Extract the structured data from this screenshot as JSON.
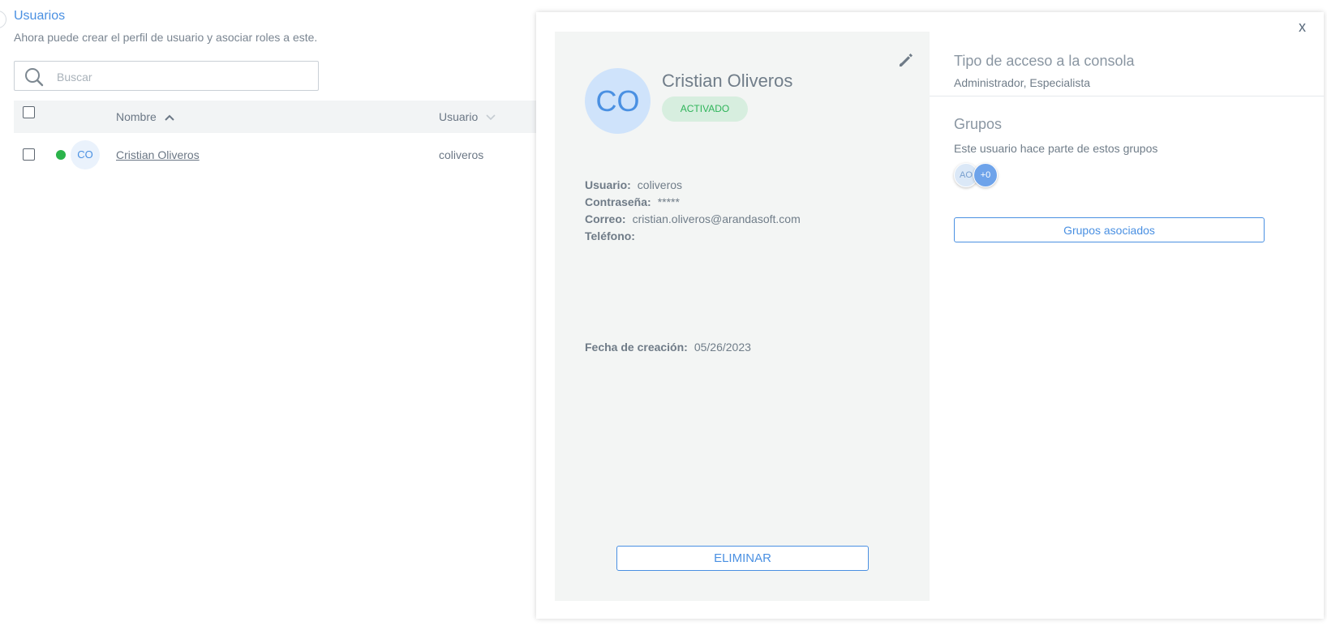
{
  "page": {
    "title": "Usuarios",
    "subtitle": "Ahora puede crear el perfil de usuario y asociar roles a este."
  },
  "search": {
    "placeholder": "Buscar",
    "value": ""
  },
  "table": {
    "columns": [
      "Nombre",
      "Usuario"
    ],
    "rows": [
      {
        "initials": "CO",
        "name": "Cristian Oliveros",
        "username": "coliveros",
        "status": "active"
      }
    ]
  },
  "detail": {
    "initials": "CO",
    "name": "Cristian Oliveros",
    "status": "ACTIVADO",
    "fields": {
      "usuario_label": "Usuario:",
      "usuario_value": "coliveros",
      "password_label": "Contraseña:",
      "password_value": "*****",
      "correo_label": "Correo:",
      "correo_value": "cristian.oliveros@arandasoft.com",
      "telefono_label": "Teléfono:",
      "telefono_value": "",
      "fecha_label": "Fecha de creación:",
      "fecha_value": "05/26/2023"
    },
    "delete_label": "ELIMINAR",
    "close_label": "x",
    "access": {
      "title": "Tipo de acceso a la consola",
      "value": "Administrador, Especialista"
    },
    "groups": {
      "title": "Grupos",
      "description": "Este usuario hace parte de estos grupos",
      "avatar_initials": "AO",
      "more_count": "+0",
      "button_label": "Grupos asociados"
    }
  },
  "colors": {
    "accent": "#4a90e2",
    "active": "#2bb34a",
    "card_bg": "#f3f5f4"
  }
}
